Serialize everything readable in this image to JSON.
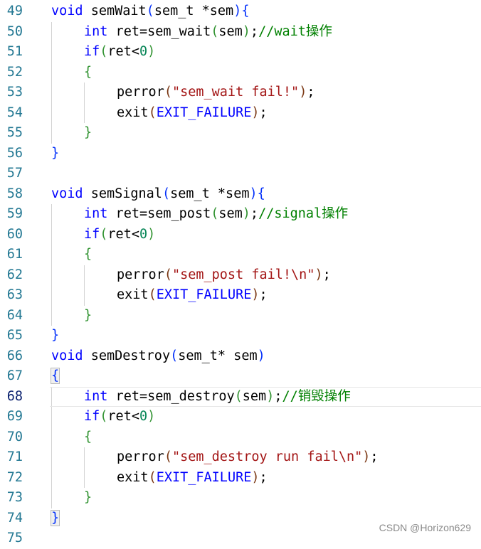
{
  "editor": {
    "lines": [
      {
        "n": "49",
        "indent": 0,
        "tokens": [
          [
            "kw",
            "void"
          ],
          [
            "pl",
            " semWait"
          ],
          [
            "p1",
            "("
          ],
          [
            "pl",
            "sem_t *sem"
          ],
          [
            "p1",
            ")"
          ],
          [
            "p1",
            "{"
          ]
        ]
      },
      {
        "n": "50",
        "indent": 1,
        "tokens": [
          [
            "kw",
            "int"
          ],
          [
            "pl",
            " ret=sem_wait"
          ],
          [
            "p2",
            "("
          ],
          [
            "pl",
            "sem"
          ],
          [
            "p2",
            ")"
          ],
          [
            "pl",
            ";"
          ],
          [
            "cm",
            "//wait操作"
          ]
        ]
      },
      {
        "n": "51",
        "indent": 1,
        "tokens": [
          [
            "kw",
            "if"
          ],
          [
            "p2",
            "("
          ],
          [
            "pl",
            "ret<"
          ],
          [
            "num",
            "0"
          ],
          [
            "p2",
            ")"
          ]
        ]
      },
      {
        "n": "52",
        "indent": 1,
        "tokens": [
          [
            "p2",
            "{"
          ]
        ]
      },
      {
        "n": "53",
        "indent": 2,
        "tokens": [
          [
            "pl",
            "perror"
          ],
          [
            "p3",
            "("
          ],
          [
            "str",
            "\"sem_wait fail!\""
          ],
          [
            "p3",
            ")"
          ],
          [
            "pl",
            ";"
          ]
        ]
      },
      {
        "n": "54",
        "indent": 2,
        "tokens": [
          [
            "pl",
            "exit"
          ],
          [
            "p3",
            "("
          ],
          [
            "mac",
            "EXIT_FAILURE"
          ],
          [
            "p3",
            ")"
          ],
          [
            "pl",
            ";"
          ]
        ]
      },
      {
        "n": "55",
        "indent": 1,
        "tokens": [
          [
            "p2",
            "}"
          ]
        ]
      },
      {
        "n": "56",
        "indent": 0,
        "tokens": [
          [
            "p1",
            "}"
          ]
        ]
      },
      {
        "n": "57",
        "indent": 0,
        "tokens": []
      },
      {
        "n": "58",
        "indent": 0,
        "tokens": [
          [
            "kw",
            "void"
          ],
          [
            "pl",
            " semSignal"
          ],
          [
            "p1",
            "("
          ],
          [
            "pl",
            "sem_t *sem"
          ],
          [
            "p1",
            ")"
          ],
          [
            "p1",
            "{"
          ]
        ]
      },
      {
        "n": "59",
        "indent": 1,
        "tokens": [
          [
            "kw",
            "int"
          ],
          [
            "pl",
            " ret=sem_post"
          ],
          [
            "p2",
            "("
          ],
          [
            "pl",
            "sem"
          ],
          [
            "p2",
            ")"
          ],
          [
            "pl",
            ";"
          ],
          [
            "cm",
            "//signal操作"
          ]
        ]
      },
      {
        "n": "60",
        "indent": 1,
        "tokens": [
          [
            "kw",
            "if"
          ],
          [
            "p2",
            "("
          ],
          [
            "pl",
            "ret<"
          ],
          [
            "num",
            "0"
          ],
          [
            "p2",
            ")"
          ]
        ]
      },
      {
        "n": "61",
        "indent": 1,
        "tokens": [
          [
            "p2",
            "{"
          ]
        ]
      },
      {
        "n": "62",
        "indent": 2,
        "tokens": [
          [
            "pl",
            "perror"
          ],
          [
            "p3",
            "("
          ],
          [
            "str",
            "\"sem_post fail!\\n\""
          ],
          [
            "p3",
            ")"
          ],
          [
            "pl",
            ";"
          ]
        ]
      },
      {
        "n": "63",
        "indent": 2,
        "tokens": [
          [
            "pl",
            "exit"
          ],
          [
            "p3",
            "("
          ],
          [
            "mac",
            "EXIT_FAILURE"
          ],
          [
            "p3",
            ")"
          ],
          [
            "pl",
            ";"
          ]
        ]
      },
      {
        "n": "64",
        "indent": 1,
        "tokens": [
          [
            "p2",
            "}"
          ]
        ]
      },
      {
        "n": "65",
        "indent": 0,
        "tokens": [
          [
            "p1",
            "}"
          ]
        ]
      },
      {
        "n": "66",
        "indent": 0,
        "tokens": [
          [
            "kw",
            "void"
          ],
          [
            "pl",
            " semDestroy"
          ],
          [
            "p1",
            "("
          ],
          [
            "pl",
            "sem_t* sem"
          ],
          [
            "p1",
            ")"
          ]
        ]
      },
      {
        "n": "67",
        "indent": 0,
        "tokens": [
          [
            "p1",
            "{"
          ]
        ]
      },
      {
        "n": "68",
        "indent": 1,
        "tokens": [
          [
            "kw",
            "int"
          ],
          [
            "pl",
            " ret=sem_destroy"
          ],
          [
            "p2",
            "("
          ],
          [
            "pl",
            "sem"
          ],
          [
            "p2",
            ")"
          ],
          [
            "pl",
            ";"
          ],
          [
            "cm",
            "//销毁操作"
          ]
        ],
        "current": true
      },
      {
        "n": "69",
        "indent": 1,
        "tokens": [
          [
            "kw",
            "if"
          ],
          [
            "p2",
            "("
          ],
          [
            "pl",
            "ret<"
          ],
          [
            "num",
            "0"
          ],
          [
            "p2",
            ")"
          ]
        ]
      },
      {
        "n": "70",
        "indent": 1,
        "tokens": [
          [
            "p2",
            "{"
          ]
        ]
      },
      {
        "n": "71",
        "indent": 2,
        "tokens": [
          [
            "pl",
            "perror"
          ],
          [
            "p3",
            "("
          ],
          [
            "str",
            "\"sem_destroy run fail\\n\""
          ],
          [
            "p3",
            ")"
          ],
          [
            "pl",
            ";"
          ]
        ]
      },
      {
        "n": "72",
        "indent": 2,
        "tokens": [
          [
            "pl",
            "exit"
          ],
          [
            "p3",
            "("
          ],
          [
            "mac",
            "EXIT_FAILURE"
          ],
          [
            "p3",
            ")"
          ],
          [
            "pl",
            ";"
          ]
        ]
      },
      {
        "n": "73",
        "indent": 1,
        "tokens": [
          [
            "p2",
            "}"
          ]
        ]
      },
      {
        "n": "74",
        "indent": 0,
        "tokens": [
          [
            "p1",
            "}"
          ]
        ]
      },
      {
        "n": "75",
        "indent": 0,
        "tokens": []
      }
    ]
  },
  "watermark": "CSDN @Horizon629"
}
